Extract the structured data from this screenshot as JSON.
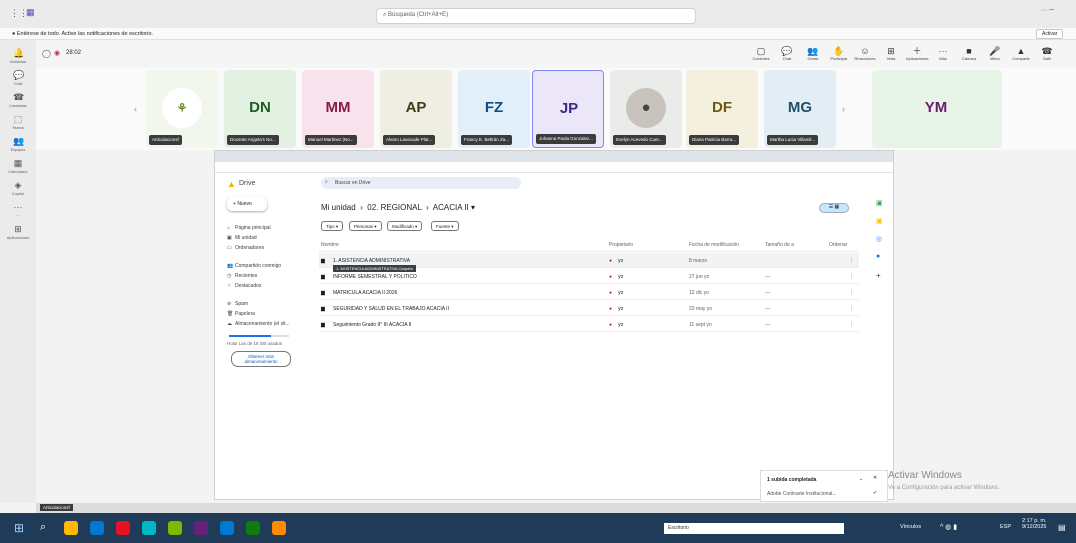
{
  "titlebar": {
    "search_placeholder": "Búsqueda (Ctrl+Alt+E)",
    "controls": "··· ─"
  },
  "notification": {
    "text": "Entérese de todo. Active las notificaciones de escritorio.",
    "button": "Activar"
  },
  "meeting": {
    "timer": "28:02"
  },
  "rail": [
    {
      "label": "Actividad",
      "icon": "bell-icon"
    },
    {
      "label": "Chat",
      "icon": "chat-icon"
    },
    {
      "label": "Llamadas",
      "icon": "phone-icon"
    },
    {
      "label": "Teams",
      "icon": "teams-icon"
    },
    {
      "label": "Equipos",
      "icon": "people-icon"
    },
    {
      "label": "Calendario",
      "icon": "calendar-icon"
    },
    {
      "label": "Copilot",
      "icon": "copilot-icon"
    },
    {
      "label": "···",
      "icon": "more-icon"
    },
    {
      "label": "Aplicaciones",
      "icon": "apps-icon"
    }
  ],
  "toolbar": [
    {
      "label": "Controles",
      "glyph": "▢"
    },
    {
      "label": "Chat",
      "glyph": "💬"
    },
    {
      "label": "Gente",
      "glyph": "👥"
    },
    {
      "label": "Participar",
      "glyph": "✋"
    },
    {
      "label": "Reacciones",
      "glyph": "☺"
    },
    {
      "label": "Vista",
      "glyph": "⊞"
    },
    {
      "label": "Aplicaciones",
      "glyph": "＋"
    },
    {
      "label": "Más",
      "glyph": "···"
    },
    {
      "label": "Cámara",
      "glyph": "■"
    },
    {
      "label": "Micro",
      "glyph": "🎤"
    },
    {
      "label": "Compartir",
      "glyph": "▲"
    },
    {
      "label": "Salir",
      "glyph": "☎"
    }
  ],
  "participants": [
    {
      "initials": "",
      "name": "Articulacionsf",
      "color": "#6b8e23",
      "bg": "#f2f7ee"
    },
    {
      "initials": "DN",
      "name": "Docente Angela's No...",
      "color": "#1b5e20",
      "bg": "#e3f1e3"
    },
    {
      "initials": "MM",
      "name": "Manuel Martinez (No...",
      "color": "#8b1a4b",
      "bg": "#f8e3ec"
    },
    {
      "initials": "AP",
      "name": "Alvaro Lavacude Plat...",
      "color": "#3e3e1a",
      "bg": "#efeee3"
    },
    {
      "initials": "FZ",
      "name": "Francy E. Beltrán Za...",
      "color": "#0b4f8a",
      "bg": "#e2eef8"
    },
    {
      "initials": "JP",
      "name": "Johanna Paola Gonzalez...",
      "color": "#3b2a8a",
      "bg": "#ebe6f8"
    },
    {
      "initials": "",
      "name": "Evelyn Acevedo Cuer...",
      "color": "#222",
      "bg": "#e9ece9"
    },
    {
      "initials": "DF",
      "name": "Diana Patricia Barra...",
      "color": "#6b5a10",
      "bg": "#f4f0e0"
    },
    {
      "initials": "MG",
      "name": "Martha Lucia Villamil...",
      "color": "#22506a",
      "bg": "#e2eef4"
    },
    {
      "initials": "YM",
      "name": "",
      "color": "#6b1a6b",
      "bg": "#e7f4e7"
    }
  ],
  "drive": {
    "logo": "Drive",
    "search_placeholder": "Buscar en Drive",
    "new_button": "Nuevo",
    "nav": [
      "Página principal",
      "Mi unidad",
      "Ordenadores",
      "Compartido conmigo",
      "Recientes",
      "Destacados",
      "Spam",
      "Papelera",
      "Almacenamiento (el sit..."
    ],
    "storage_text": "Hola! Las de 15 GB usados",
    "storage_button": "Obtener más almacenamiento",
    "breadcrumb": [
      "Mi unidad",
      "02. REGIONAL",
      "ACACIA II"
    ],
    "filters": [
      "Tipo",
      "Personas",
      "Modificado",
      "Fuente"
    ],
    "columns": [
      "Nombre",
      "Propietario",
      "Fecha de modificación",
      "Tamaño de a",
      "Ordenar"
    ],
    "rows": [
      {
        "name": "1. ASISTENCIA ADMINISTRATIVA",
        "tooltip": "1. ASISTENCIA ADMINISTRATIVA Carpeta",
        "owner": "yo",
        "date": "8 marzo",
        "size": ""
      },
      {
        "name": "INFORME SEMESTRAL Y POLITICO",
        "owner": "yo",
        "date": "27 jun yo",
        "size": "—"
      },
      {
        "name": "MATRICULA ACACIA II 2026",
        "owner": "yo",
        "date": "12 dic yo",
        "size": "—"
      },
      {
        "name": "SEGURIDAD Y SALUD EN EL TRABAJO ACACIA II",
        "owner": "yo",
        "date": "23 may yo",
        "size": "—"
      },
      {
        "name": "Seguimiento Grado 9° III ACACIA II",
        "owner": "yo",
        "date": "11 sept yo",
        "size": "—"
      }
    ]
  },
  "upload": {
    "title": "1 subida completada",
    "item": "Adobe Contraste Institucional..."
  },
  "watermark": {
    "line1": "Activar Windows",
    "line2": "Ve a Configuración para activar Windows."
  },
  "taskbar": {
    "search_text": "Escritorio",
    "links": "Vínculos",
    "lang": "ESP",
    "time": "2:17 p. m.",
    "date": "9/12/2025"
  },
  "teams_mini": {
    "presenter": "Articulacionsf"
  }
}
